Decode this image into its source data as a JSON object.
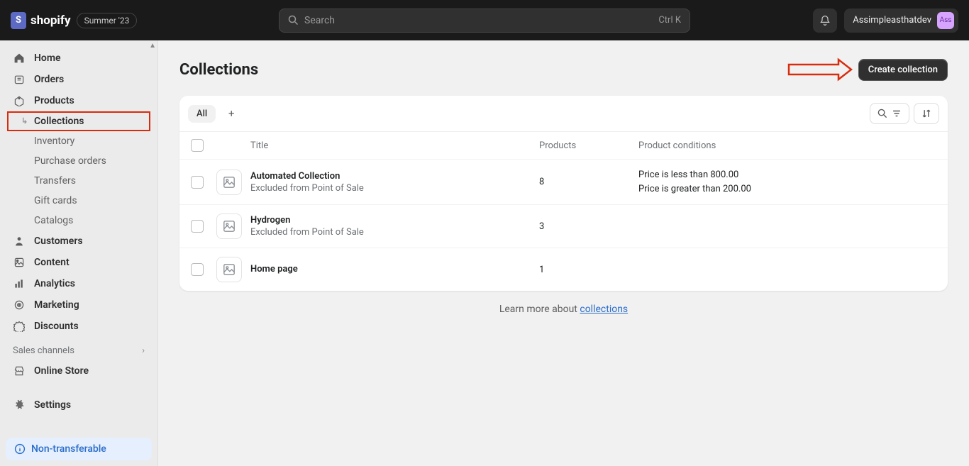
{
  "header": {
    "brand": "shopify",
    "badge": "Summer '23",
    "search_placeholder": "Search",
    "search_shortcut": "Ctrl K",
    "username": "Assimpleasthatdev",
    "avatar_text": "Ass"
  },
  "sidebar": {
    "home": "Home",
    "orders": "Orders",
    "products": "Products",
    "collections": "Collections",
    "inventory": "Inventory",
    "purchase_orders": "Purchase orders",
    "transfers": "Transfers",
    "gift_cards": "Gift cards",
    "catalogs": "Catalogs",
    "customers": "Customers",
    "content": "Content",
    "analytics": "Analytics",
    "marketing": "Marketing",
    "discounts": "Discounts",
    "sales_channels": "Sales channels",
    "online_store": "Online Store",
    "settings": "Settings",
    "non_transferable": "Non-transferable"
  },
  "page": {
    "title": "Collections",
    "create_button": "Create collection",
    "tab_all": "All",
    "col_title": "Title",
    "col_products": "Products",
    "col_conditions": "Product conditions",
    "learn_text": "Learn more about ",
    "learn_link": "collections"
  },
  "rows": [
    {
      "title": "Automated Collection",
      "sub": "Excluded from Point of Sale",
      "products": "8",
      "conditions": [
        "Price is less than 800.00",
        "Price is greater than 200.00"
      ]
    },
    {
      "title": "Hydrogen",
      "sub": "Excluded from Point of Sale",
      "products": "3",
      "conditions": []
    },
    {
      "title": "Home page",
      "sub": "",
      "products": "1",
      "conditions": []
    }
  ]
}
